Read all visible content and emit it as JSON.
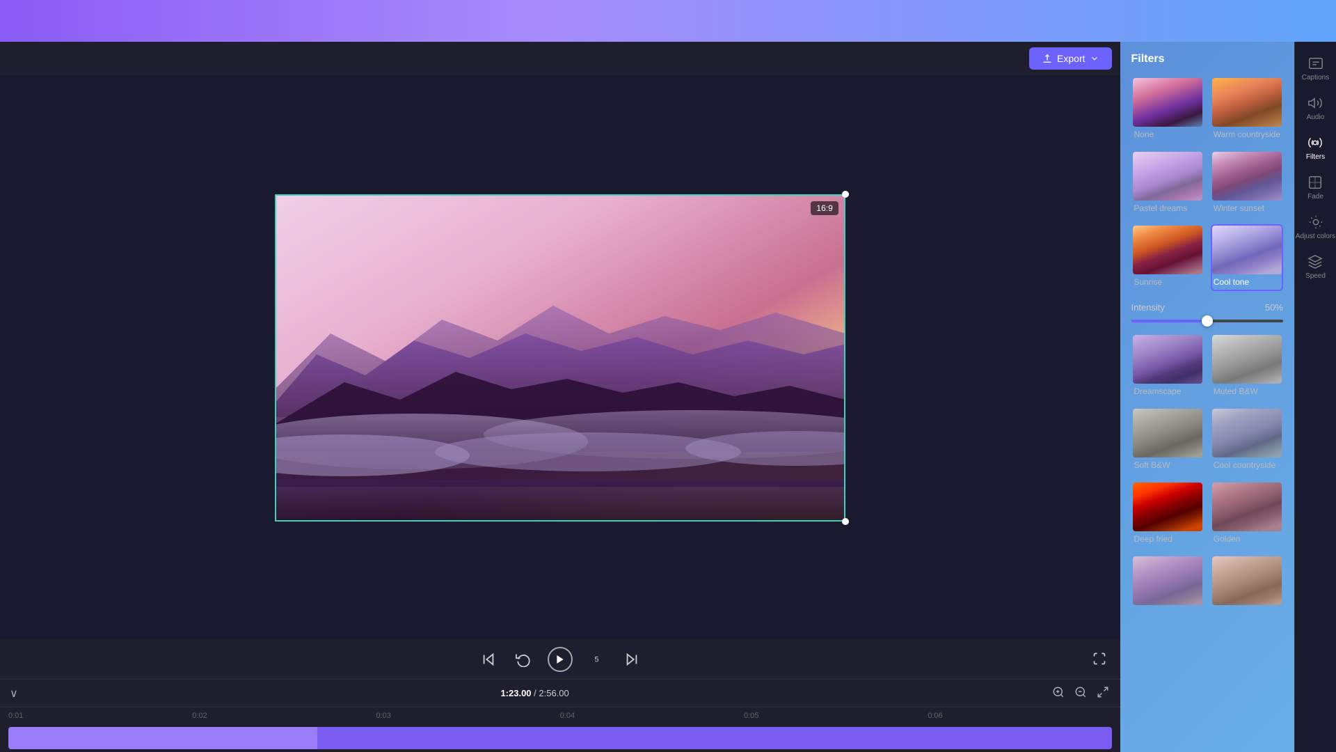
{
  "topbar": {
    "export_label": "Export"
  },
  "video": {
    "aspect_ratio": "16:9",
    "current_time": "1:23.00",
    "total_time": "2:56.00"
  },
  "timeline": {
    "ruler_ticks": [
      "0:01",
      "0:02",
      "0:03",
      "0:04",
      "0:05",
      "0:06"
    ]
  },
  "filters": {
    "panel_title": "Filters",
    "intensity_label": "Intensity",
    "intensity_value": "50%",
    "items": [
      {
        "id": "none",
        "label": "None",
        "selected": false
      },
      {
        "id": "warm-countryside",
        "label": "Warm countryside",
        "selected": false
      },
      {
        "id": "pastel-dreams",
        "label": "Pastel dreams",
        "selected": false
      },
      {
        "id": "winter-sunset",
        "label": "Winter sunset",
        "selected": false
      },
      {
        "id": "sunrise",
        "label": "Sunrise",
        "selected": false
      },
      {
        "id": "cool-tone",
        "label": "Cool tone",
        "selected": true
      },
      {
        "id": "dreamscape",
        "label": "Dreamscape",
        "selected": false
      },
      {
        "id": "muted-bw",
        "label": "Muted B&W",
        "selected": false
      },
      {
        "id": "soft-bw",
        "label": "Soft B&W",
        "selected": false
      },
      {
        "id": "cool-countryside",
        "label": "Cool countryside",
        "selected": false
      },
      {
        "id": "deep-fried",
        "label": "Deep fried",
        "selected": false
      },
      {
        "id": "golden",
        "label": "Golden",
        "selected": false
      },
      {
        "id": "extra1",
        "label": "",
        "selected": false
      },
      {
        "id": "extra2",
        "label": "",
        "selected": false
      }
    ]
  },
  "sidebar": {
    "items": [
      {
        "id": "captions",
        "label": "Captions"
      },
      {
        "id": "audio",
        "label": "Audio"
      },
      {
        "id": "filters",
        "label": "Filters"
      },
      {
        "id": "fade",
        "label": "Fade"
      },
      {
        "id": "adjust-colors",
        "label": "Adjust colors"
      },
      {
        "id": "speed",
        "label": "Speed"
      }
    ]
  }
}
